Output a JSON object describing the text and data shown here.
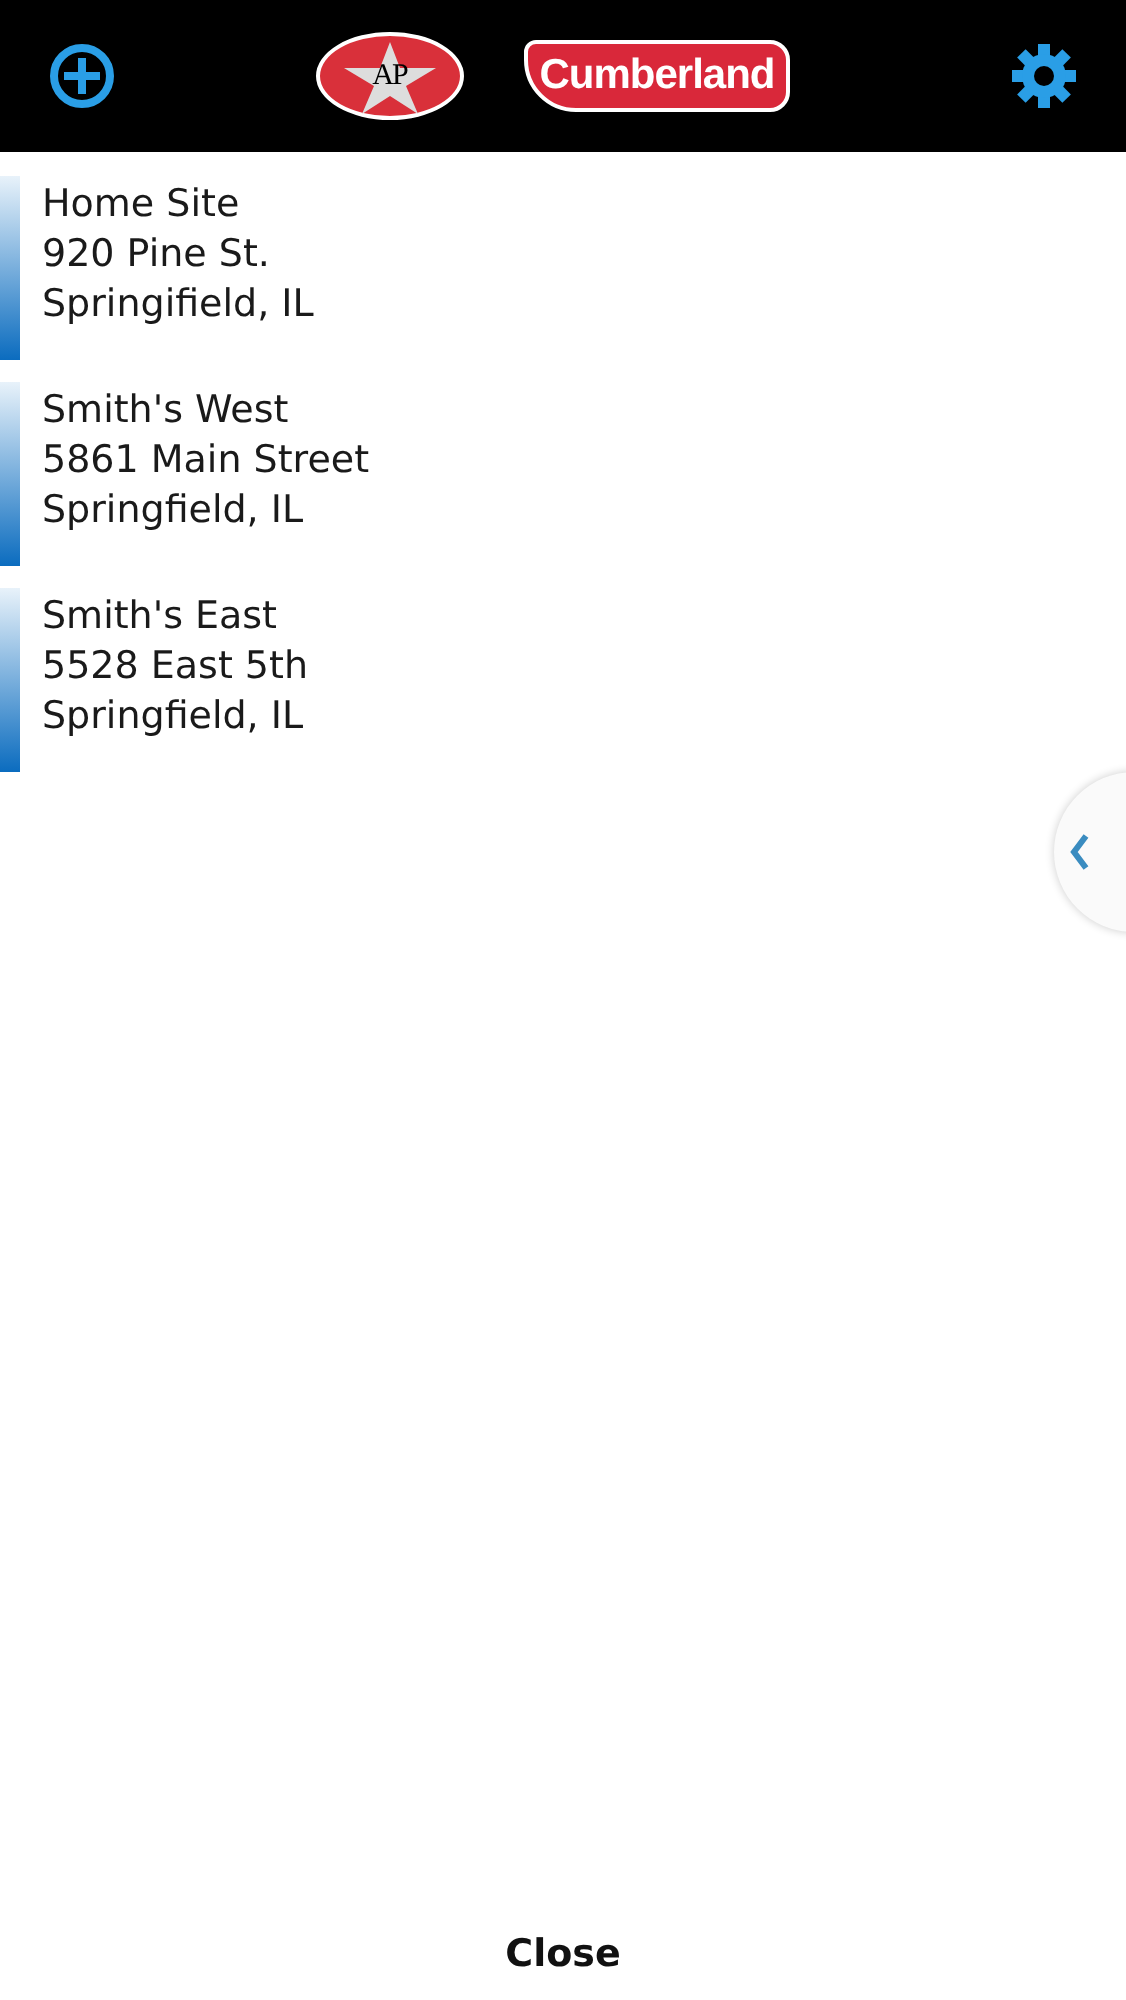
{
  "header": {
    "logo_left": "AP",
    "logo_right": "Cumberland"
  },
  "sites": [
    {
      "name": "Home Site",
      "street": "920 Pine St.",
      "city": "Springifield, IL"
    },
    {
      "name": "Smith's West",
      "street": "5861 Main Street",
      "city": "Springfield, IL"
    },
    {
      "name": "Smith's East",
      "street": "5528 East 5th",
      "city": "Springfield, IL"
    }
  ],
  "footer": {
    "close": "Close"
  }
}
